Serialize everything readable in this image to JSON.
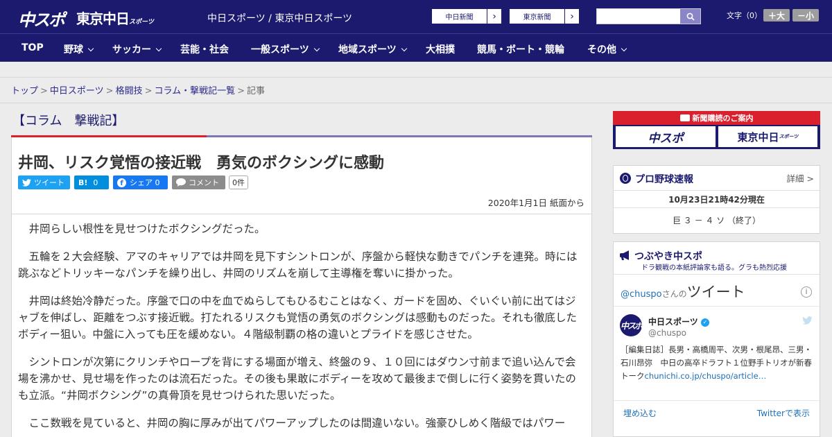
{
  "header": {
    "logo_chuspo": "中スポ",
    "logo_tokyo": "東京中日",
    "logo_tokyo_sub": "スポーツ",
    "site_title": "中日スポーツ / 東京中日スポーツ",
    "link_chunichi": "中日新聞",
    "link_tokyo": "東京新聞",
    "search_placeholder": "",
    "font_size_label": "文字（0）",
    "font_bigger": "＋大",
    "font_smaller": "－小"
  },
  "nav": [
    {
      "label": "TOP",
      "has_menu": false
    },
    {
      "label": "野球",
      "has_menu": true
    },
    {
      "label": "サッカー",
      "has_menu": true
    },
    {
      "label": "芸能・社会",
      "has_menu": false
    },
    {
      "label": "一般スポーツ",
      "has_menu": true
    },
    {
      "label": "地域スポーツ",
      "has_menu": true
    },
    {
      "label": "大相撲",
      "has_menu": false
    },
    {
      "label": "競馬・ボート・競輪",
      "has_menu": false
    },
    {
      "label": "その他",
      "has_menu": true
    }
  ],
  "breadcrumb": {
    "items": [
      "トップ",
      "中日スポーツ",
      "格闘技",
      "コラム・撃戦記一覧"
    ],
    "current": "記事",
    "separator": ">"
  },
  "article": {
    "column_title": "【コラム　撃戦記】",
    "headline": "井岡、リスク覚悟の接近戦　勇気のボクシングに感動",
    "share": {
      "tweet": "ツイート",
      "hatena": "0",
      "facebook": "シェア 0",
      "comment": "コメント",
      "comment_count": "0件"
    },
    "date": "2020年1月1日 紙面から",
    "paragraphs": [
      "井岡らしい根性を見せつけたボクシングだった。",
      "五輪を２大会経験、アマのキャリアでは井岡を見下すシントロンが、序盤から軽快な動きでパンチを連発。時には跳ぶなどトリッキーなパンチを繰り出し、井岡のリズムを崩して主導権を奪いに掛かった。",
      "井岡は終始冷静だった。序盤で口の中を血でぬらしてもひるむことはなく、ガードを固め、ぐいぐい前に出てはジャブを伸ばし、距離をつぶす接近戦。打たれるリスクも覚悟の勇気のボクシングは感動ものだった。それも徹底したボディー狙い。中盤に入っても圧を緩めない。４階級制覇の格の違いとプライドを感じさせた。",
      "シントロンが次第にクリンチやロープを背にする場面が増え、終盤の９、１０回にはダウン寸前まで追い込んで会場を沸かせ、見せ場を作ったのは流石だった。その後も果敢にボディーを攻めて最後まで倒しに行く姿勢を貫いたのも立派。“井岡ボクシング”の真骨頂を見せつけられた思いだった。",
      "ここ数戦を見ていると、井岡の胸に厚みが出てパワーアップしたのは間違いない。強豪ひしめく階級ではパワー"
    ]
  },
  "sidebar": {
    "ad": {
      "title": "新聞購読のご案内",
      "logo_chuspo": "中スポ",
      "logo_tokyo": "東京中日",
      "logo_tokyo_sub": "スポーツ"
    },
    "baseball": {
      "title": "プロ野球速報",
      "detail_link": "詳細 >",
      "timestamp": "10月23日21時42分現在",
      "result": "巨 ３ － ４ ソ （終了）"
    },
    "twitter": {
      "title": "つぶやき中スポ",
      "subtitle": "ドラ観戦の本紙評論家も語る。グラも熱烈応援",
      "handle_prefix": "@chuspo",
      "handle_suffix": "さんの",
      "tweets_word": "ツイート",
      "account_name": "中日スポーツ",
      "account_handle": "@chuspo",
      "tweet_text": "［編集日誌］長男・高橋周平、次男・根尾昂、三男・石川昂弥　中日の高卒ドラフト１位野手トリオが新春トーク",
      "tweet_link": "chunichi.co.jp/chuspo/article…",
      "embed": "埋め込む",
      "view_on_twitter": "Twitterで表示"
    }
  },
  "colors": {
    "brand_navy": "#1b1a6f",
    "accent_red": "#d9202c",
    "twitter_blue": "#1da1f2",
    "hatena_blue": "#008fde",
    "facebook_blue": "#1877f2"
  }
}
